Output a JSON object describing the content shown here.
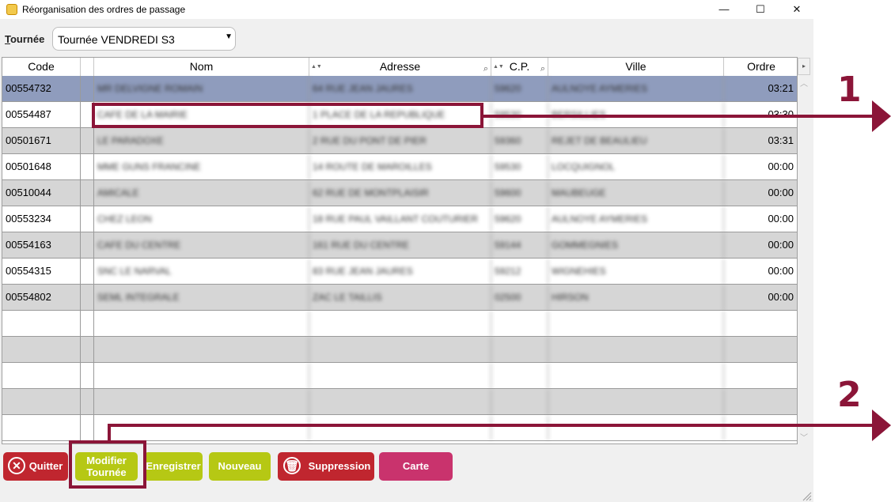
{
  "window": {
    "title": "Réorganisation des ordres de passage",
    "minimize_glyph": "—",
    "maximize_glyph": "☐",
    "close_glyph": "✕"
  },
  "tournee": {
    "label_first": "T",
    "label_rest": "ournée",
    "selected": "Tournée VENDREDI S3"
  },
  "columns": {
    "code": "Code",
    "nom": "Nom",
    "adresse": "Adresse",
    "cp": "C.P.",
    "ville": "Ville",
    "ordre": "Ordre"
  },
  "rows": [
    {
      "code": "00554732",
      "nom": "MR DELVIGNE ROMAIN",
      "adresse": "64 RUE JEAN JAURES",
      "cp": "59620",
      "ville": "AULNOYE AYMERIES",
      "ordre": "03:21"
    },
    {
      "code": "00554487",
      "nom": "CAFE DE LA MAIRIE",
      "adresse": "1 PLACE DE LA REPUBLIQUE",
      "cp": "59530",
      "ville": "BERSILLIES",
      "ordre": "03:30"
    },
    {
      "code": "00501671",
      "nom": "LE PARADOXE",
      "adresse": "2 RUE DU PONT DE PIER",
      "cp": "59360",
      "ville": "REJET DE BEAULIEU",
      "ordre": "03:31"
    },
    {
      "code": "00501648",
      "nom": "MME GUNS FRANCINE",
      "adresse": "14 ROUTE DE MAROILLES",
      "cp": "59530",
      "ville": "LOCQUIGNOL",
      "ordre": "00:00"
    },
    {
      "code": "00510044",
      "nom": "AMICALE",
      "adresse": "62 RUE DE MONTPLAISIR",
      "cp": "59600",
      "ville": "MAUBEUGE",
      "ordre": "00:00"
    },
    {
      "code": "00553234",
      "nom": "CHEZ LEON",
      "adresse": "18 RUE PAUL VAILLANT COUTURIER",
      "cp": "59620",
      "ville": "AULNOYE AYMERIES",
      "ordre": "00:00"
    },
    {
      "code": "00554163",
      "nom": "CAFE DU CENTRE",
      "adresse": "161 RUE DU CENTRE",
      "cp": "59144",
      "ville": "GOMMEGNIES",
      "ordre": "00:00"
    },
    {
      "code": "00554315",
      "nom": "SNC LE NARVAL",
      "adresse": "83 RUE JEAN JAURES",
      "cp": "59212",
      "ville": "WIGNEHIES",
      "ordre": "00:00"
    },
    {
      "code": "00554802",
      "nom": "SEML INTEGRALE",
      "adresse": "ZAC LE TAILLIS",
      "cp": "02500",
      "ville": "HIRSON",
      "ordre": "00:00"
    }
  ],
  "buttons": {
    "quitter": "Quitter",
    "modifier_l1": "Modifier",
    "modifier_l2": "Tournée",
    "enregistrer": "Enregistrer",
    "nouveau": "Nouveau",
    "suppression": "Suppression",
    "carte": "Carte"
  },
  "annotations": {
    "one": "1",
    "two": "2"
  },
  "colors": {
    "selected_row": "#8f9cbd",
    "accent_green": "#b6c814",
    "accent_red": "#c0262f",
    "accent_pink": "#c9336d",
    "annotation": "#8b1538"
  }
}
